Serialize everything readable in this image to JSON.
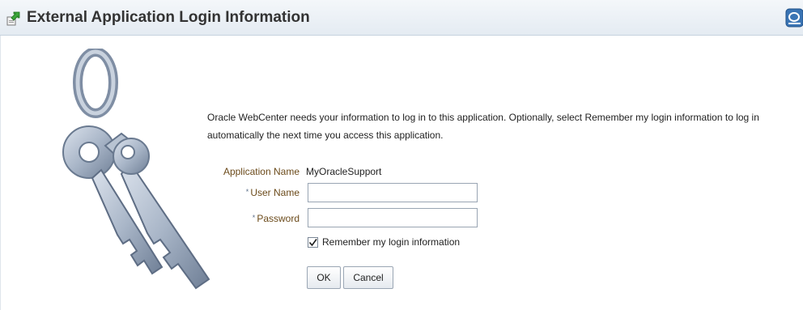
{
  "header": {
    "title": "External Application Login Information",
    "icon": "green-arrow-app-icon",
    "panel_button_icon": "oracle-panel-icon"
  },
  "main": {
    "illustration": "keys-icon",
    "intro_text": "Oracle WebCenter needs your information to log in to this application. Optionally, select Remember my login information to log in automatically the next time you access this application.",
    "application_name_label": "Application Name",
    "application_name_value": "MyOracleSupport",
    "required_mark": "*",
    "user_name_label": "User Name",
    "user_name_value": "",
    "password_label": "Password",
    "password_value": "",
    "remember_label": "Remember my login information",
    "remember_checked": true,
    "ok_label": "OK",
    "cancel_label": "Cancel"
  },
  "colors": {
    "label": "#6b4a1a",
    "header_bg": "#e8eef4",
    "accent": "#2b6fb3"
  }
}
